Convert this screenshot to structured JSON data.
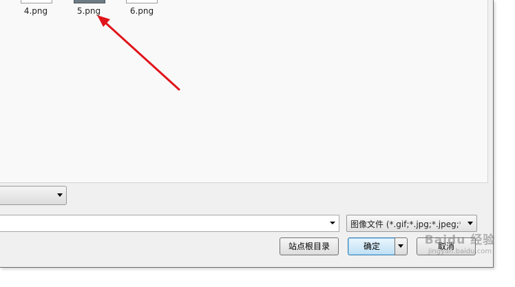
{
  "files": [
    {
      "name": "4.png"
    },
    {
      "name": "5.png"
    },
    {
      "name": "6.png"
    }
  ],
  "path_combo": {
    "value": ""
  },
  "filename_combo": {
    "value": ""
  },
  "filter_combo": {
    "value": "图像文件 (*.gif;*.jpg;*.jpeg;*.p"
  },
  "buttons": {
    "site_root": "站点根目录",
    "ok": "确定",
    "cancel": "取消"
  },
  "watermark": {
    "logo": "Baidu 经验",
    "url": "jingyan.baidu.com"
  },
  "annotation": {
    "color": "#e0141b"
  }
}
